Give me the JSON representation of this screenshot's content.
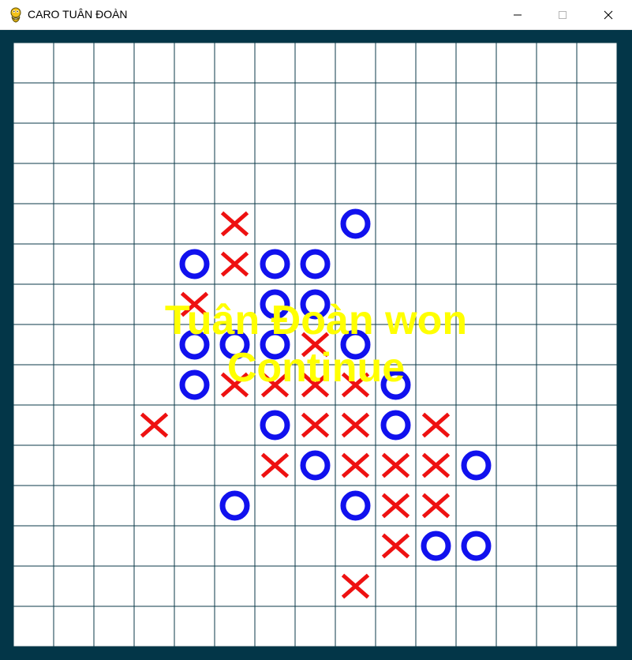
{
  "window": {
    "title": "CARO TUÂN ĐOÀN",
    "app_icon": "python-snake-icon",
    "controls": [
      "minimize-icon",
      "maximize-icon",
      "close-icon"
    ]
  },
  "game": {
    "board_size": 15,
    "colors": {
      "frame": "#033648",
      "cell": "#ffffff",
      "grid_line": "#0b3a48",
      "x_mark": "#ee1111",
      "o_mark": "#1111ee",
      "overlay_text": "#ffff00"
    },
    "cells": [
      {
        "row": 4,
        "col": 5,
        "mark": "X"
      },
      {
        "row": 4,
        "col": 8,
        "mark": "O"
      },
      {
        "row": 5,
        "col": 4,
        "mark": "O"
      },
      {
        "row": 5,
        "col": 5,
        "mark": "X"
      },
      {
        "row": 5,
        "col": 6,
        "mark": "O"
      },
      {
        "row": 5,
        "col": 7,
        "mark": "O"
      },
      {
        "row": 6,
        "col": 4,
        "mark": "X"
      },
      {
        "row": 6,
        "col": 6,
        "mark": "O"
      },
      {
        "row": 6,
        "col": 7,
        "mark": "O"
      },
      {
        "row": 7,
        "col": 4,
        "mark": "O"
      },
      {
        "row": 7,
        "col": 5,
        "mark": "O"
      },
      {
        "row": 7,
        "col": 6,
        "mark": "O"
      },
      {
        "row": 7,
        "col": 7,
        "mark": "X"
      },
      {
        "row": 7,
        "col": 8,
        "mark": "O"
      },
      {
        "row": 8,
        "col": 4,
        "mark": "O"
      },
      {
        "row": 8,
        "col": 5,
        "mark": "X"
      },
      {
        "row": 8,
        "col": 6,
        "mark": "X"
      },
      {
        "row": 8,
        "col": 7,
        "mark": "X"
      },
      {
        "row": 8,
        "col": 8,
        "mark": "X"
      },
      {
        "row": 8,
        "col": 9,
        "mark": "O"
      },
      {
        "row": 9,
        "col": 3,
        "mark": "X"
      },
      {
        "row": 9,
        "col": 6,
        "mark": "O"
      },
      {
        "row": 9,
        "col": 7,
        "mark": "X"
      },
      {
        "row": 9,
        "col": 8,
        "mark": "X"
      },
      {
        "row": 9,
        "col": 9,
        "mark": "O"
      },
      {
        "row": 9,
        "col": 10,
        "mark": "X"
      },
      {
        "row": 10,
        "col": 6,
        "mark": "X"
      },
      {
        "row": 10,
        "col": 7,
        "mark": "O"
      },
      {
        "row": 10,
        "col": 8,
        "mark": "X"
      },
      {
        "row": 10,
        "col": 9,
        "mark": "X"
      },
      {
        "row": 10,
        "col": 10,
        "mark": "X"
      },
      {
        "row": 10,
        "col": 11,
        "mark": "O"
      },
      {
        "row": 11,
        "col": 5,
        "mark": "O"
      },
      {
        "row": 11,
        "col": 8,
        "mark": "O"
      },
      {
        "row": 11,
        "col": 9,
        "mark": "X"
      },
      {
        "row": 11,
        "col": 10,
        "mark": "X"
      },
      {
        "row": 12,
        "col": 9,
        "mark": "X"
      },
      {
        "row": 12,
        "col": 10,
        "mark": "O"
      },
      {
        "row": 12,
        "col": 11,
        "mark": "O"
      },
      {
        "row": 13,
        "col": 8,
        "mark": "X"
      }
    ],
    "result_message": "Tuân Đoàn won",
    "continue_label": "Continue"
  }
}
